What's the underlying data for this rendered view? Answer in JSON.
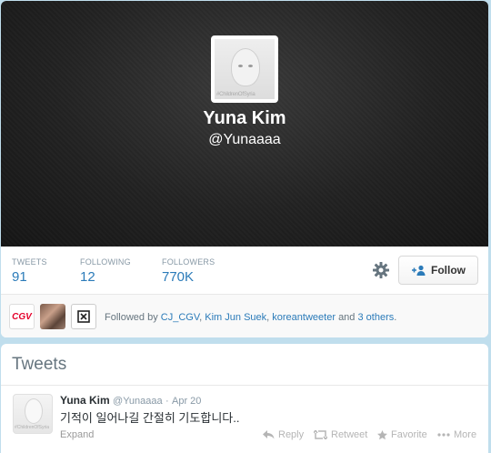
{
  "profile": {
    "name": "Yuna Kim",
    "handle": "@Yunaaaa",
    "avatar_caption": "#ChildrenOfSyria"
  },
  "stats": [
    {
      "label": "TWEETS",
      "value": "91"
    },
    {
      "label": "FOLLOWING",
      "value": "12"
    },
    {
      "label": "FOLLOWERS",
      "value": "770K"
    }
  ],
  "actions": {
    "follow_label": "Follow",
    "settings_icon": "gear-icon"
  },
  "followed_by": {
    "prefix": "Followed by",
    "names": [
      "CJ_CGV",
      "Kim Jun Suek",
      "koreantweeter"
    ],
    "and_text": "and",
    "others": "3 others",
    "thumb_logo": "CGV"
  },
  "tweets_section": {
    "title": "Tweets",
    "tweet": {
      "name": "Yuna Kim",
      "handle": "@Yunaaaa",
      "dot": "·",
      "date": "Apr 20",
      "text": "기적이 일어나길 간절히 기도합니다..",
      "expand_label": "Expand",
      "reply_label": "Reply",
      "retweet_label": "Retweet",
      "favorite_label": "Favorite",
      "more_label": "More"
    }
  },
  "colors": {
    "link": "#2b7bb9",
    "page_bg": "#c0deed",
    "cgv_red": "#e4002b"
  }
}
